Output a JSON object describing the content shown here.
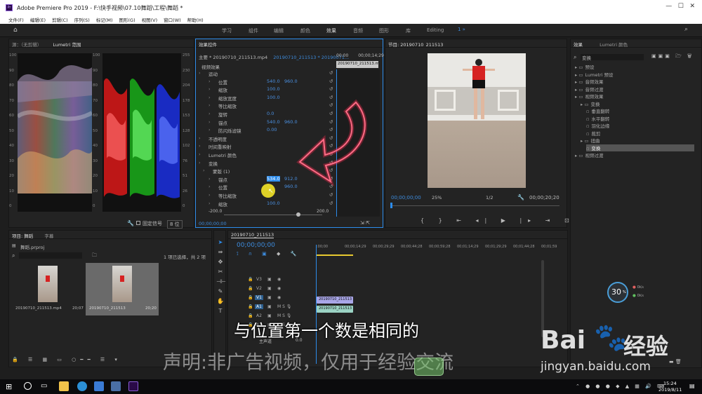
{
  "window": {
    "title": "Adobe Premiere Pro 2019 - F:\\快手视频\\07.10舞蹈\\工程\\舞蹈 *"
  },
  "menu": [
    "文件(F)",
    "编辑(E)",
    "剪辑(C)",
    "序列(S)",
    "标记(M)",
    "图形(G)",
    "视图(V)",
    "窗口(W)",
    "帮助(H)"
  ],
  "workspaces": [
    "学习",
    "组件",
    "编辑",
    "颜色",
    "效果",
    "音频",
    "图形",
    "库",
    "Editing"
  ],
  "scope_panel": {
    "tab_source": "源：（无剪辑）",
    "tab_lumetri": "Lumetri 范围",
    "left_ticks": [
      "100",
      "90",
      "80",
      "70",
      "60",
      "50",
      "40",
      "30",
      "20",
      "10",
      "0"
    ],
    "right_ticks": [
      "255",
      "230",
      "204",
      "178",
      "153",
      "128",
      "102",
      "76",
      "51",
      "26",
      "0"
    ],
    "mid_ticks": [
      "100",
      "90",
      "80",
      "70",
      "60",
      "50",
      "40",
      "30",
      "20",
      "10",
      "0"
    ],
    "bitdepth": "8 位",
    "clamp_label": "固定信号"
  },
  "effects_panel": {
    "tab": "效果控件",
    "master": "主要 * 20190710_211513.mp4",
    "seq": "20190710_211513 * 20190071...",
    "clip_label": "20190710_211513.mp",
    "time_a": "00:00",
    "time_b": "00;00;14;29",
    "section_video": "视频效果",
    "rows": [
      {
        "label": "运动"
      },
      {
        "label": "位置",
        "v1": "540.0",
        "v2": "960.0"
      },
      {
        "label": "缩放",
        "v1": "100.0"
      },
      {
        "label": "缩放宽度",
        "v1": "100.0"
      },
      {
        "label": "等比缩放"
      },
      {
        "label": "旋转",
        "v1": "0.0"
      },
      {
        "label": "锚点",
        "v1": "540.0",
        "v2": "960.0"
      },
      {
        "label": "防闪烁滤镜",
        "v1": "0.00"
      },
      {
        "label": "不透明度"
      },
      {
        "label": "时间重映射"
      },
      {
        "label": "Lumetri 颜色"
      },
      {
        "label": "变换"
      },
      {
        "label": "蒙版 (1)"
      },
      {
        "label": "锚点",
        "v1": "534.0",
        "v2": "912.0"
      },
      {
        "label": "位置",
        "v1": "",
        "v2": "960.0"
      },
      {
        "label": "等比缩放"
      },
      {
        "label": "缩放",
        "v1": "100.0"
      }
    ],
    "slider_min": "-200.0",
    "slider_max": "200.0",
    "timecode": "00;00;00;00"
  },
  "program_panel": {
    "tab": "节目: 20190710_211513",
    "timecode": "00;00;00;00",
    "zoom": "25%",
    "quality": "1/2",
    "duration": "00;00;20;20"
  },
  "effects_browser": {
    "tab": "效果",
    "tab2": "Lumetri 颜色",
    "search": "变换",
    "tree": [
      {
        "label": "预设",
        "indent": 0
      },
      {
        "label": "Lumetri 预设",
        "indent": 0
      },
      {
        "label": "音频效果",
        "indent": 0
      },
      {
        "label": "音频过渡",
        "indent": 0
      },
      {
        "label": "视频效果",
        "indent": 0
      },
      {
        "label": "变换",
        "indent": 1
      },
      {
        "label": "垂直翻转",
        "indent": 2
      },
      {
        "label": "水平翻转",
        "indent": 2
      },
      {
        "label": "羽化边缘",
        "indent": 2
      },
      {
        "label": "裁剪",
        "indent": 2
      },
      {
        "label": "扭曲",
        "indent": 1
      },
      {
        "label": "变换",
        "indent": 2,
        "selected": true
      },
      {
        "label": "视频过渡",
        "indent": 0
      }
    ]
  },
  "project_panel": {
    "tab": "项目: 舞蹈",
    "tab2": "字幕",
    "file": "舞蹈.prproj",
    "selection": "1 项已选择，共 2 项",
    "items": [
      {
        "name": "20190710_211513.mp4",
        "dur": "20;07"
      },
      {
        "name": "20190710_211513",
        "dur": "20;20"
      }
    ]
  },
  "timeline": {
    "tab": "20190710_211513",
    "timecode": "00;00;00;00",
    "ruler": [
      ":00;00",
      "00;00;14;29",
      "00;00;29;29",
      "00;00;44;28",
      "00;00;59;28",
      "00;01;14;29",
      "00;01;29;29",
      "00;01;44;28",
      "00;01;59"
    ],
    "tracks": [
      "V3",
      "V2",
      "V1",
      "A1",
      "A2",
      "A3"
    ],
    "master": "主声道",
    "master_val": "0.0",
    "clip_v": "20190710_211513",
    "clip_a": "20190710_211513"
  },
  "perf": {
    "percent": "30",
    "unit": "%",
    "up": "0",
    "down": "0",
    "speed_unit": "K/s"
  },
  "subtitle": "与位置第一个数是相同的",
  "watermark": "声明:非广告视频，仅用于经验交流",
  "baidu": {
    "brand": "Bai",
    "suffix": "经验",
    "url": "jingyan.baidu.com"
  },
  "clock": {
    "time": "15:24",
    "date": "2019/8/11"
  },
  "colors": {
    "accent": "#2d8ceb",
    "arrow": "#ff2a4f",
    "clip_video": "#a9a6e8",
    "clip_audio": "#9bd3c4"
  }
}
